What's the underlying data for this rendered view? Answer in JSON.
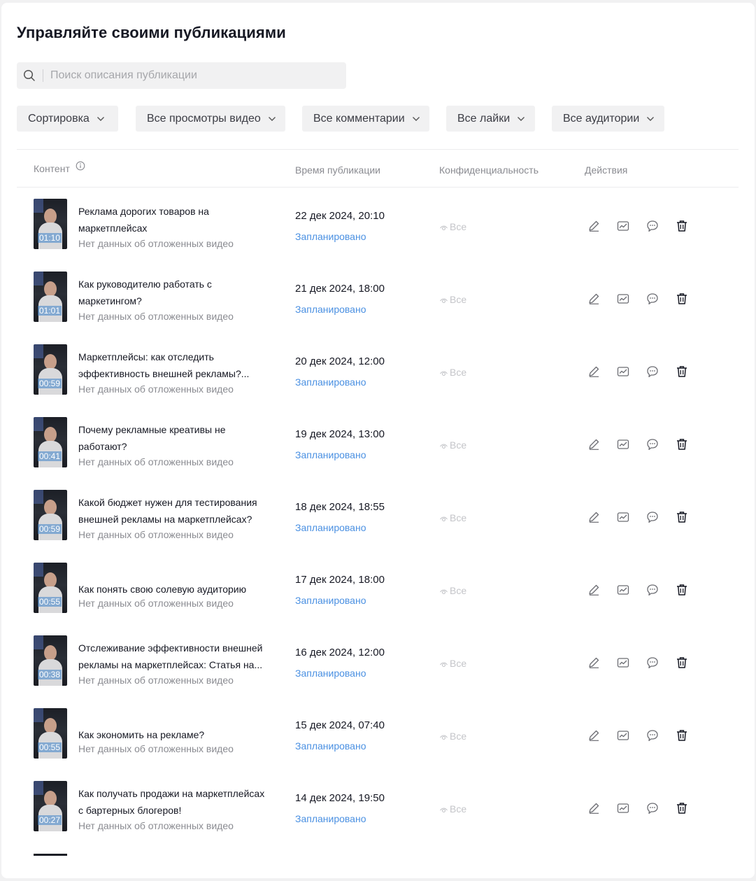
{
  "page_title": "Управляйте своими публикациями",
  "search": {
    "placeholder": "Поиск описания публикации"
  },
  "filters": [
    {
      "label": "Сортировка"
    },
    {
      "label": "Все просмотры видео"
    },
    {
      "label": "Все комментарии"
    },
    {
      "label": "Все лайки"
    },
    {
      "label": "Все аудитории"
    }
  ],
  "table": {
    "headers": {
      "content": "Контент",
      "time": "Время публикации",
      "privacy": "Конфиденциальность",
      "actions": "Действия"
    },
    "rows": [
      {
        "title": "Реклама дорогих товаров на маркетплейсах",
        "subtitle": "Нет данных об отложенных видео",
        "duration": "01:10",
        "date": "22 дек 2024, 20:10",
        "status": "Запланировано",
        "privacy": "Все"
      },
      {
        "title": "Как руководителю работать с маркетингом?",
        "subtitle": "Нет данных об отложенных видео",
        "duration": "01:01",
        "date": "21 дек 2024, 18:00",
        "status": "Запланировано",
        "privacy": "Все"
      },
      {
        "title": "Маркетплейсы: как отследить эффективность внешней рекламы?...",
        "subtitle": "Нет данных об отложенных видео",
        "duration": "00:59",
        "date": "20 дек 2024, 12:00",
        "status": "Запланировано",
        "privacy": "Все"
      },
      {
        "title": "Почему рекламные креативы не работают?",
        "subtitle": "Нет данных об отложенных видео",
        "duration": "00:41",
        "date": "19 дек 2024, 13:00",
        "status": "Запланировано",
        "privacy": "Все"
      },
      {
        "title": "Какой бюджет нужен для тестирования внешней рекламы на маркетплейсах?",
        "subtitle": "Нет данных об отложенных видео",
        "duration": "00:59",
        "date": "18 дек 2024, 18:55",
        "status": "Запланировано",
        "privacy": "Все"
      },
      {
        "title": "Как понять свою солевую аудиторию",
        "subtitle": "Нет данных об отложенных видео",
        "duration": "00:55",
        "date": "17 дек 2024, 18:00",
        "status": "Запланировано",
        "privacy": "Все"
      },
      {
        "title": "Отслеживание эффективности внешней рекламы на маркетплейсах: Статья на...",
        "subtitle": "Нет данных об отложенных видео",
        "duration": "00:38",
        "date": "16 дек 2024, 12:00",
        "status": "Запланировано",
        "privacy": "Все"
      },
      {
        "title": "Как экономить на рекламе?",
        "subtitle": "Нет данных об отложенных видео",
        "duration": "00:55",
        "date": "15 дек 2024, 07:40",
        "status": "Запланировано",
        "privacy": "Все"
      },
      {
        "title": "Как получать продажи на маркетплейсах с бартерных блогеров!",
        "subtitle": "Нет данных об отложенных видео",
        "duration": "00:27",
        "date": "14 дек 2024, 19:50",
        "status": "Запланировано",
        "privacy": "Все"
      }
    ]
  },
  "icons": {
    "search": "search-icon",
    "chevron": "chevron-down-icon",
    "info": "info-icon",
    "privacy": "eye-icon",
    "edit": "pencil-icon",
    "analytics": "chart-icon",
    "comments": "comment-icon",
    "delete": "trash-icon"
  },
  "colors": {
    "accent_link": "#4a90e2",
    "muted_text": "#8a8b91",
    "field_bg": "#f1f1f2"
  }
}
